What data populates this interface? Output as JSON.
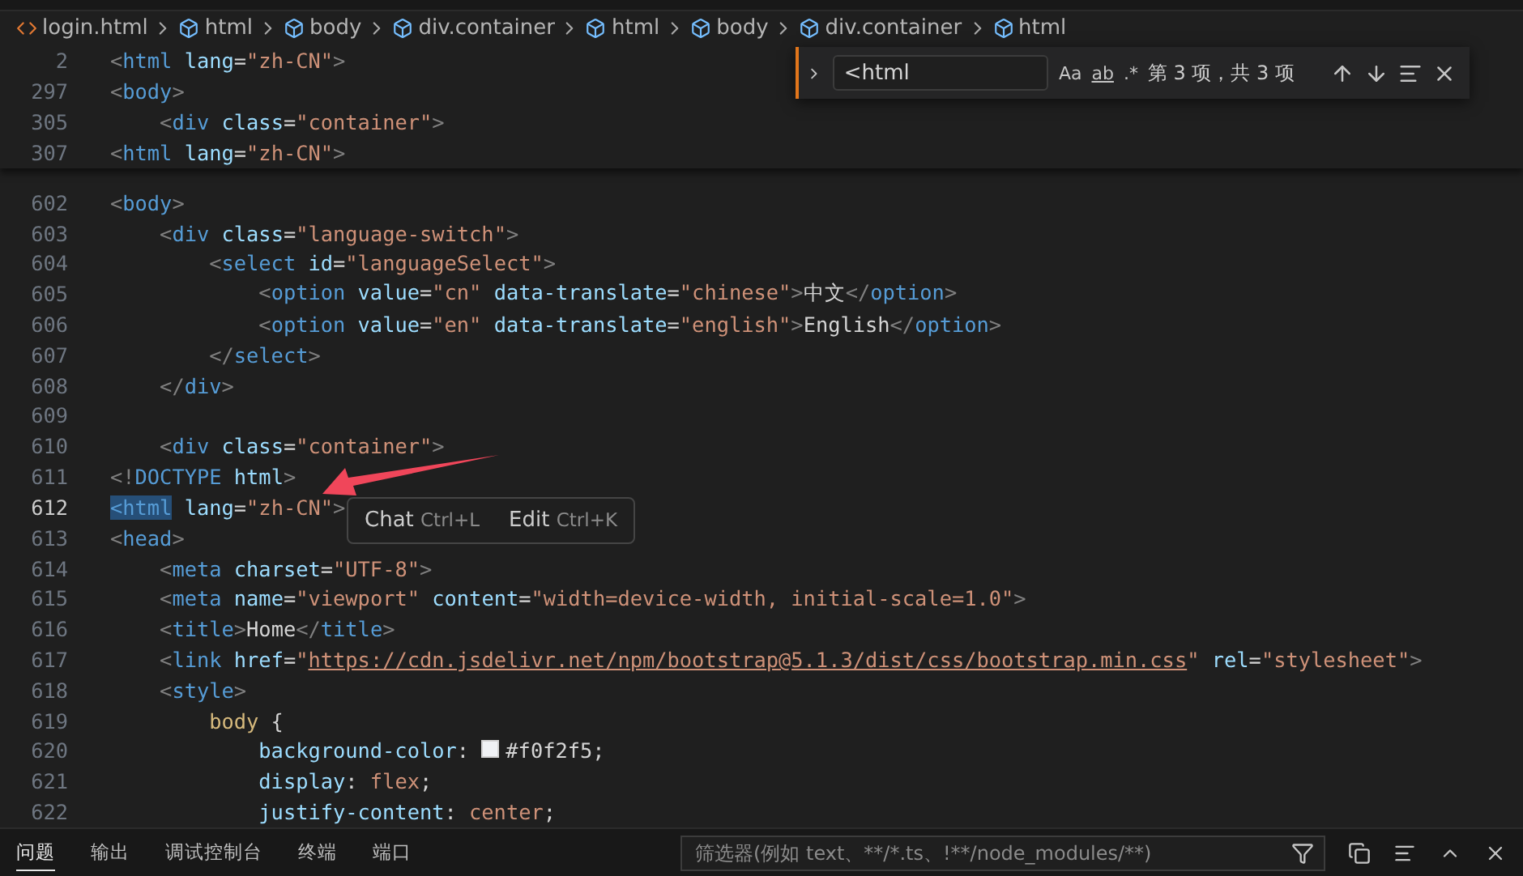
{
  "breadcrumb": [
    {
      "label": "login.html",
      "kind": "file"
    },
    {
      "label": "html",
      "kind": "element"
    },
    {
      "label": "body",
      "kind": "element"
    },
    {
      "label": "div.container",
      "kind": "element"
    },
    {
      "label": "html",
      "kind": "element"
    },
    {
      "label": "body",
      "kind": "element"
    },
    {
      "label": "div.container",
      "kind": "element"
    },
    {
      "label": "html",
      "kind": "element"
    }
  ],
  "sticky_lines": [
    {
      "number": "2",
      "tokens": [
        {
          "t": "<",
          "kind": "p"
        },
        {
          "t": "html",
          "kind": "tag"
        },
        {
          "t": " lang",
          "kind": "attr"
        },
        {
          "t": "=",
          "kind": "text"
        },
        {
          "t": "\"zh-CN\"",
          "kind": "str"
        },
        {
          "t": ">",
          "kind": "p"
        }
      ]
    },
    {
      "number": "297",
      "tokens": [
        {
          "t": "<",
          "kind": "p"
        },
        {
          "t": "body",
          "kind": "tag"
        },
        {
          "t": ">",
          "kind": "p"
        }
      ]
    },
    {
      "number": "305",
      "tokens": [
        {
          "t": "    <",
          "kind": "p"
        },
        {
          "t": "div",
          "kind": "tag"
        },
        {
          "t": " class",
          "kind": "attr"
        },
        {
          "t": "=",
          "kind": "text"
        },
        {
          "t": "\"container\"",
          "kind": "str"
        },
        {
          "t": ">",
          "kind": "p"
        }
      ]
    },
    {
      "number": "307",
      "tokens": [
        {
          "t": "<",
          "kind": "p"
        },
        {
          "t": "html",
          "kind": "tag"
        },
        {
          "t": " lang",
          "kind": "attr"
        },
        {
          "t": "=",
          "kind": "text"
        },
        {
          "t": "\"zh-CN\"",
          "kind": "str"
        },
        {
          "t": ">",
          "kind": "p"
        }
      ]
    }
  ],
  "lines": [
    {
      "number": "602",
      "current": false,
      "tokens": [
        {
          "t": "<",
          "kind": "p"
        },
        {
          "t": "body",
          "kind": "tag"
        },
        {
          "t": ">",
          "kind": "p"
        }
      ]
    },
    {
      "number": "603",
      "current": false,
      "tokens": [
        {
          "t": "    <",
          "kind": "p"
        },
        {
          "t": "div",
          "kind": "tag"
        },
        {
          "t": " class",
          "kind": "attr"
        },
        {
          "t": "=",
          "kind": "text"
        },
        {
          "t": "\"language-switch\"",
          "kind": "str"
        },
        {
          "t": ">",
          "kind": "p"
        }
      ]
    },
    {
      "number": "604",
      "current": false,
      "tokens": [
        {
          "t": "        <",
          "kind": "p"
        },
        {
          "t": "select",
          "kind": "tag"
        },
        {
          "t": " id",
          "kind": "attr"
        },
        {
          "t": "=",
          "kind": "text"
        },
        {
          "t": "\"languageSelect\"",
          "kind": "str"
        },
        {
          "t": ">",
          "kind": "p"
        }
      ]
    },
    {
      "number": "605",
      "current": false,
      "tokens": [
        {
          "t": "            <",
          "kind": "p"
        },
        {
          "t": "option",
          "kind": "tag"
        },
        {
          "t": " value",
          "kind": "attr"
        },
        {
          "t": "=",
          "kind": "text"
        },
        {
          "t": "\"cn\"",
          "kind": "str"
        },
        {
          "t": " data-translate",
          "kind": "attr"
        },
        {
          "t": "=",
          "kind": "text"
        },
        {
          "t": "\"chinese\"",
          "kind": "str"
        },
        {
          "t": ">",
          "kind": "p"
        },
        {
          "t": "中文",
          "kind": "text"
        },
        {
          "t": "</",
          "kind": "p"
        },
        {
          "t": "option",
          "kind": "tag"
        },
        {
          "t": ">",
          "kind": "p"
        }
      ]
    },
    {
      "number": "606",
      "current": false,
      "tokens": [
        {
          "t": "            <",
          "kind": "p"
        },
        {
          "t": "option",
          "kind": "tag"
        },
        {
          "t": " value",
          "kind": "attr"
        },
        {
          "t": "=",
          "kind": "text"
        },
        {
          "t": "\"en\"",
          "kind": "str"
        },
        {
          "t": " data-translate",
          "kind": "attr"
        },
        {
          "t": "=",
          "kind": "text"
        },
        {
          "t": "\"english\"",
          "kind": "str"
        },
        {
          "t": ">",
          "kind": "p"
        },
        {
          "t": "English",
          "kind": "text"
        },
        {
          "t": "</",
          "kind": "p"
        },
        {
          "t": "option",
          "kind": "tag"
        },
        {
          "t": ">",
          "kind": "p"
        }
      ]
    },
    {
      "number": "607",
      "current": false,
      "tokens": [
        {
          "t": "        </",
          "kind": "p"
        },
        {
          "t": "select",
          "kind": "tag"
        },
        {
          "t": ">",
          "kind": "p"
        }
      ]
    },
    {
      "number": "608",
      "current": false,
      "tokens": [
        {
          "t": "    </",
          "kind": "p"
        },
        {
          "t": "div",
          "kind": "tag"
        },
        {
          "t": ">",
          "kind": "p"
        }
      ]
    },
    {
      "number": "609",
      "current": false
    },
    {
      "number": "610",
      "current": false,
      "tokens": [
        {
          "t": "    <",
          "kind": "p"
        },
        {
          "t": "div",
          "kind": "tag"
        },
        {
          "t": " class",
          "kind": "attr"
        },
        {
          "t": "=",
          "kind": "text"
        },
        {
          "t": "\"container\"",
          "kind": "str"
        },
        {
          "t": ">",
          "kind": "p"
        }
      ]
    },
    {
      "number": "611",
      "current": false,
      "tokens": [
        {
          "t": "<!",
          "kind": "p"
        },
        {
          "t": "DOCTYPE",
          "kind": "tag"
        },
        {
          "t": " html",
          "kind": "attr"
        },
        {
          "t": ">",
          "kind": "p"
        }
      ]
    },
    {
      "number": "612",
      "current": true,
      "tokens": [
        {
          "t": "<html",
          "kind": "tag",
          "highlight": true
        },
        {
          "t": " lang",
          "kind": "attr"
        },
        {
          "t": "=",
          "kind": "text"
        },
        {
          "t": "\"zh-CN\"",
          "kind": "str"
        },
        {
          "t": ">",
          "kind": "p"
        }
      ]
    },
    {
      "number": "613",
      "current": false,
      "tokens": [
        {
          "t": "<",
          "kind": "p"
        },
        {
          "t": "head",
          "kind": "tag"
        },
        {
          "t": ">",
          "kind": "p"
        }
      ]
    },
    {
      "number": "614",
      "current": false,
      "tokens": [
        {
          "t": "    <",
          "kind": "p"
        },
        {
          "t": "meta",
          "kind": "tag"
        },
        {
          "t": " charset",
          "kind": "attr"
        },
        {
          "t": "=",
          "kind": "text"
        },
        {
          "t": "\"UTF-8\"",
          "kind": "str"
        },
        {
          "t": ">",
          "kind": "p"
        }
      ]
    },
    {
      "number": "615",
      "current": false,
      "tokens": [
        {
          "t": "    <",
          "kind": "p"
        },
        {
          "t": "meta",
          "kind": "tag"
        },
        {
          "t": " name",
          "kind": "attr"
        },
        {
          "t": "=",
          "kind": "text"
        },
        {
          "t": "\"viewport\"",
          "kind": "str"
        },
        {
          "t": " content",
          "kind": "attr"
        },
        {
          "t": "=",
          "kind": "text"
        },
        {
          "t": "\"width=device-width, initial-scale=1.0\"",
          "kind": "str"
        },
        {
          "t": ">",
          "kind": "p"
        }
      ]
    },
    {
      "number": "616",
      "current": false,
      "tokens": [
        {
          "t": "    <",
          "kind": "p"
        },
        {
          "t": "title",
          "kind": "tag"
        },
        {
          "t": ">",
          "kind": "p"
        },
        {
          "t": "Home",
          "kind": "text"
        },
        {
          "t": "</",
          "kind": "p"
        },
        {
          "t": "title",
          "kind": "tag"
        },
        {
          "t": ">",
          "kind": "p"
        }
      ]
    },
    {
      "number": "617",
      "current": false,
      "tokens": [
        {
          "t": "    <",
          "kind": "p"
        },
        {
          "t": "link",
          "kind": "tag"
        },
        {
          "t": " href",
          "kind": "attr"
        },
        {
          "t": "=",
          "kind": "text"
        },
        {
          "t": "\"",
          "kind": "str"
        },
        {
          "t": "https://cdn.jsdelivr.net/npm/bootstrap@5.1.3/dist/css/bootstrap.min.css",
          "kind": "link"
        },
        {
          "t": "\"",
          "kind": "str"
        },
        {
          "t": " rel",
          "kind": "attr"
        },
        {
          "t": "=",
          "kind": "text"
        },
        {
          "t": "\"stylesheet\"",
          "kind": "str"
        },
        {
          "t": ">",
          "kind": "p"
        }
      ]
    },
    {
      "number": "618",
      "current": false,
      "tokens": [
        {
          "t": "    <",
          "kind": "p"
        },
        {
          "t": "style",
          "kind": "tag"
        },
        {
          "t": ">",
          "kind": "p"
        }
      ]
    },
    {
      "number": "619",
      "current": false,
      "tokens": [
        {
          "t": "        body",
          "kind": "sel"
        },
        {
          "t": " {",
          "kind": "text"
        }
      ]
    },
    {
      "number": "620",
      "current": false,
      "tokens": [
        {
          "t": "            background-color",
          "kind": "attr"
        },
        {
          "t": ": ",
          "kind": "text"
        },
        {
          "t": "#f0f2f5",
          "kind": "color",
          "color": "#f0f2f5"
        },
        {
          "t": ";",
          "kind": "text"
        }
      ]
    },
    {
      "number": "621",
      "current": false,
      "tokens": [
        {
          "t": "            display",
          "kind": "attr"
        },
        {
          "t": ": ",
          "kind": "text"
        },
        {
          "t": "flex",
          "kind": "str"
        },
        {
          "t": ";",
          "kind": "text"
        }
      ]
    },
    {
      "number": "622",
      "current": false,
      "tokens": [
        {
          "t": "            justify-content",
          "kind": "attr"
        },
        {
          "t": ": ",
          "kind": "text"
        },
        {
          "t": "center",
          "kind": "str"
        },
        {
          "t": ";",
          "kind": "text"
        }
      ]
    }
  ],
  "find": {
    "value": "<html",
    "toggles": [
      "Aa",
      "ab",
      ".*"
    ],
    "result": "第 3 项，共 3 项"
  },
  "inline_menu": [
    {
      "label": "Chat",
      "shortcut": "Ctrl+L"
    },
    {
      "label": "Edit",
      "shortcut": "Ctrl+K"
    }
  ],
  "panel": {
    "tabs": [
      {
        "label": "问题",
        "selected": true
      },
      {
        "label": "输出",
        "selected": false
      },
      {
        "label": "调试控制台",
        "selected": false
      },
      {
        "label": "终端",
        "selected": false
      },
      {
        "label": "端口",
        "selected": false
      }
    ],
    "filter": {
      "placeholder": "筛选器(例如 text、**/*.ts、!**/node_modules/**)"
    }
  }
}
